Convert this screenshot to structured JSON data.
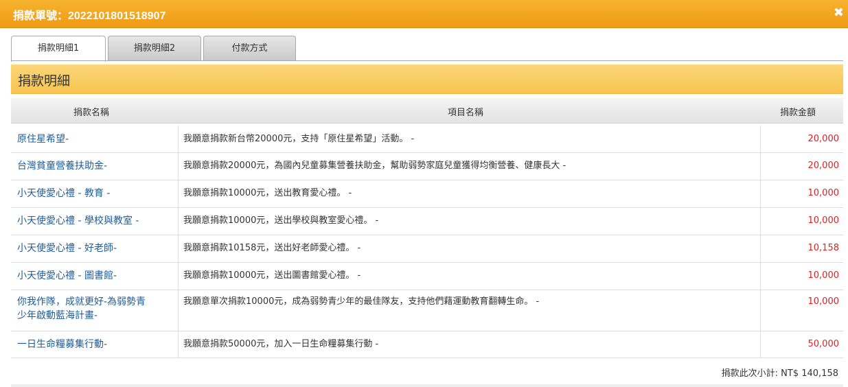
{
  "dialog": {
    "title": "捐款單號：2022101801518907",
    "close_icon": "✖"
  },
  "tabs": [
    {
      "label": "捐款明細1",
      "active": true
    },
    {
      "label": "捐款明細2",
      "active": false
    },
    {
      "label": "付款方式",
      "active": false
    }
  ],
  "section": {
    "title": "捐款明細"
  },
  "table": {
    "headers": {
      "name": "捐款名稱",
      "project": "項目名稱",
      "amount": "捐款金額"
    },
    "rows": [
      {
        "name": "原住星希望-",
        "desc": "我願意捐款新台幣20000元，支持「原住星希望」活動。 -",
        "amount": "20,000"
      },
      {
        "name": "台灣貧童營養扶助金-",
        "desc": "我願意捐款20000元，為國內兒童募集營養扶助金，幫助弱勢家庭兒童獲得均衡營養、健康長大 -",
        "amount": "20,000"
      },
      {
        "name": "小天使愛心禮 - 教育 -",
        "desc": "我願意捐款10000元，送出教育愛心禮。 -",
        "amount": "10,000"
      },
      {
        "name": "小天使愛心禮 - 學校與教室 -",
        "desc": "我願意捐款10000元，送出學校與教室愛心禮。 -",
        "amount": "10,000"
      },
      {
        "name": "小天使愛心禮 - 好老師-",
        "desc": "我願意捐款10158元，送出好老師愛心禮。 -",
        "amount": "10,158"
      },
      {
        "name": "小天使愛心禮 - 圖書館-",
        "desc": "我願意捐款10000元，送出圖書館愛心禮。 -",
        "amount": "10,000"
      },
      {
        "name_line1": "你我作隊，成就更好-為弱勢青",
        "name_line2": "少年啟動藍海計畫-",
        "desc": "我願意單次捐款10000元，成為弱勢青少年的最佳隊友，支持他們藉運動教育翻轉生命。 -",
        "amount": "10,000"
      },
      {
        "name": "一日生命糧募集行動-",
        "desc": "我願意捐款50000元，加入一日生命糧募集行動 -",
        "amount": "50,000"
      }
    ]
  },
  "subtotal": "捐款此次小計: NT$ 140,158",
  "colors": {
    "accent": "#f7b32e",
    "link": "#1f5c99",
    "amount": "#e02020"
  }
}
